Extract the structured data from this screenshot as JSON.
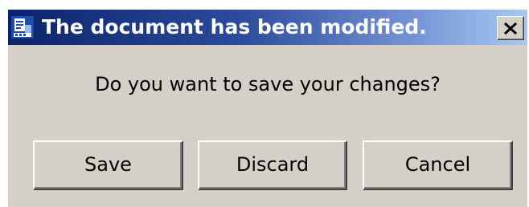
{
  "dialog": {
    "title": "The document has been modified.",
    "close_label": "X",
    "icon": "document-app-icon",
    "message": "Do you want to save your changes?",
    "buttons": {
      "save": "Save",
      "discard": "Discard",
      "cancel": "Cancel"
    }
  },
  "colors": {
    "title_gradient_start": "#0a246a",
    "title_gradient_end": "#a6caf0",
    "window_background": "#d4d0c8",
    "title_text": "#ffffff"
  }
}
